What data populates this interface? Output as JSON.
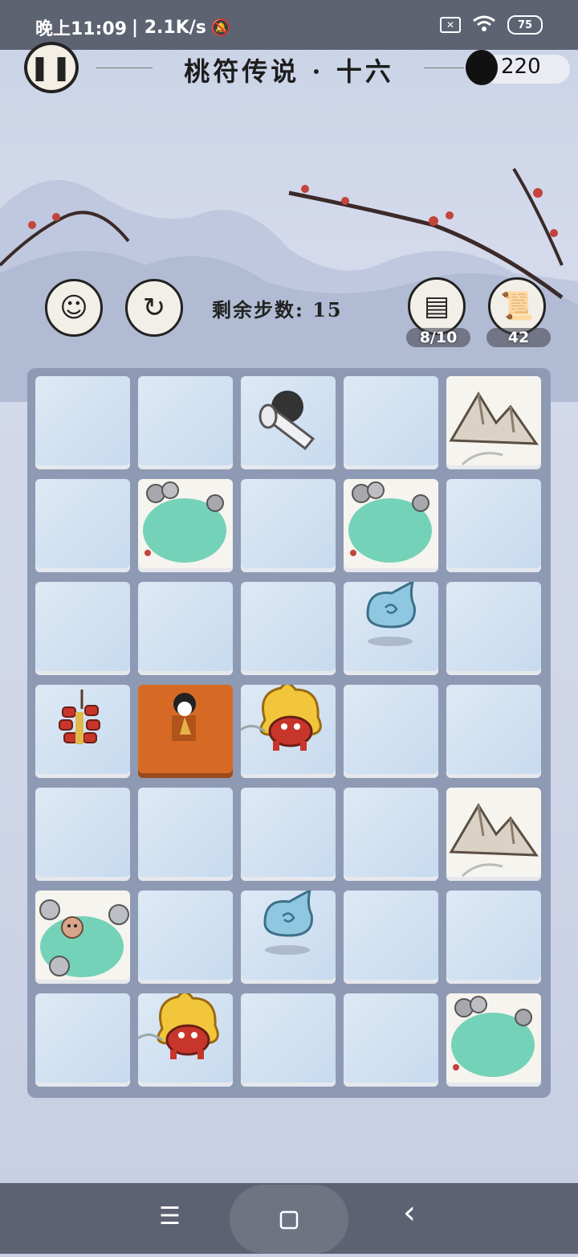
{
  "status_bar": {
    "time": "晚上11:09",
    "net_speed": "| 2.1K/s",
    "battery": "75"
  },
  "header": {
    "title": "桃符传说 · 十六",
    "ink_count": "220"
  },
  "toolbar": {
    "steps_label": "剩余步数:",
    "steps_value": "15",
    "card_count": "8/10",
    "scroll_count": "42"
  },
  "board": {
    "cols": 5,
    "rows": 7,
    "tiles": [
      {
        "type": "hero",
        "col": 2,
        "row": 0
      },
      {
        "type": "mountain",
        "col": 4,
        "row": 0
      },
      {
        "type": "pond",
        "col": 1,
        "row": 1
      },
      {
        "type": "pond",
        "col": 3,
        "row": 1
      },
      {
        "type": "spirit",
        "col": 3,
        "row": 2
      },
      {
        "type": "firecracker",
        "col": 0,
        "row": 3
      },
      {
        "type": "temple",
        "col": 1,
        "row": 3
      },
      {
        "type": "nian-beast",
        "col": 2,
        "row": 3
      },
      {
        "type": "mountain",
        "col": 4,
        "row": 4
      },
      {
        "type": "monkey-pond",
        "col": 0,
        "row": 5
      },
      {
        "type": "spirit",
        "col": 2,
        "row": 5
      },
      {
        "type": "nian-beast",
        "col": 1,
        "row": 6
      },
      {
        "type": "pond",
        "col": 4,
        "row": 6
      }
    ]
  },
  "colors": {
    "board": "#8e9ab3",
    "tile": "#d3e3f2",
    "temple": "#d66a25",
    "pond": "#74d2b8"
  },
  "nav": {
    "menu_icon": "☰",
    "back_icon": "‹"
  }
}
